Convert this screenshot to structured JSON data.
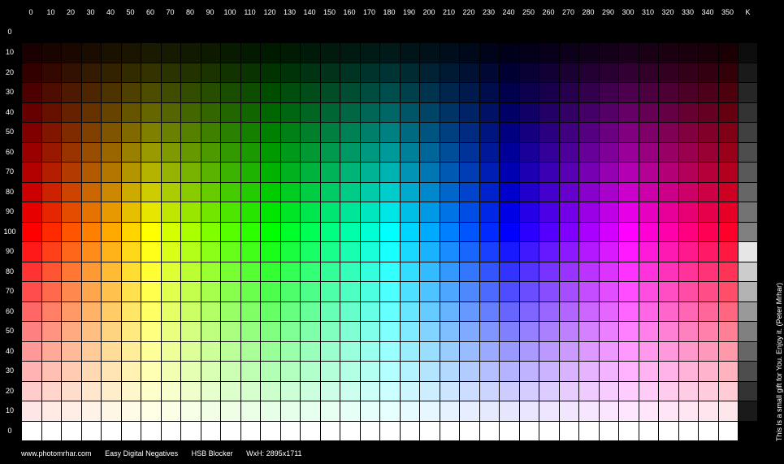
{
  "header": {
    "hue_labels": [
      "0",
      "10",
      "20",
      "30",
      "40",
      "50",
      "60",
      "70",
      "80",
      "90",
      "100",
      "110",
      "120",
      "130",
      "140",
      "150",
      "160",
      "170",
      "180",
      "190",
      "200",
      "210",
      "220",
      "230",
      "240",
      "250",
      "260",
      "270",
      "280",
      "290",
      "300",
      "310",
      "320",
      "330",
      "340",
      "350"
    ],
    "gray_label": "K"
  },
  "row_labels": [
    "0",
    "10",
    "20",
    "30",
    "40",
    "50",
    "60",
    "70",
    "80",
    "90",
    "100",
    "90",
    "80",
    "70",
    "60",
    "50",
    "40",
    "30",
    "20",
    "10",
    "0"
  ],
  "footer": {
    "website": "www.photomrhar.com",
    "product": "Easy Digital Negatives",
    "tool": "HSB Blocker",
    "dimensions": "WxH: 2895x1711"
  },
  "side_note": "This is a small gift for You. Enjoy it. (Peter Mrhar)",
  "grid": {
    "hue_step_degrees": 10,
    "brightness_rows": [
      0,
      10,
      20,
      30,
      40,
      50,
      60,
      70,
      80,
      90,
      100,
      100,
      100,
      100,
      100,
      100,
      100,
      100,
      100,
      100,
      100
    ],
    "saturation_rows": [
      100,
      100,
      100,
      100,
      100,
      100,
      100,
      100,
      100,
      100,
      100,
      90,
      80,
      70,
      60,
      50,
      40,
      30,
      20,
      10,
      0
    ],
    "gray_levels": [
      0,
      10,
      20,
      30,
      40,
      50,
      60,
      70,
      80,
      90,
      100,
      90,
      80,
      70,
      60,
      50,
      40,
      30,
      20,
      10,
      0
    ],
    "gray_direction_lower_half": "lighter"
  }
}
